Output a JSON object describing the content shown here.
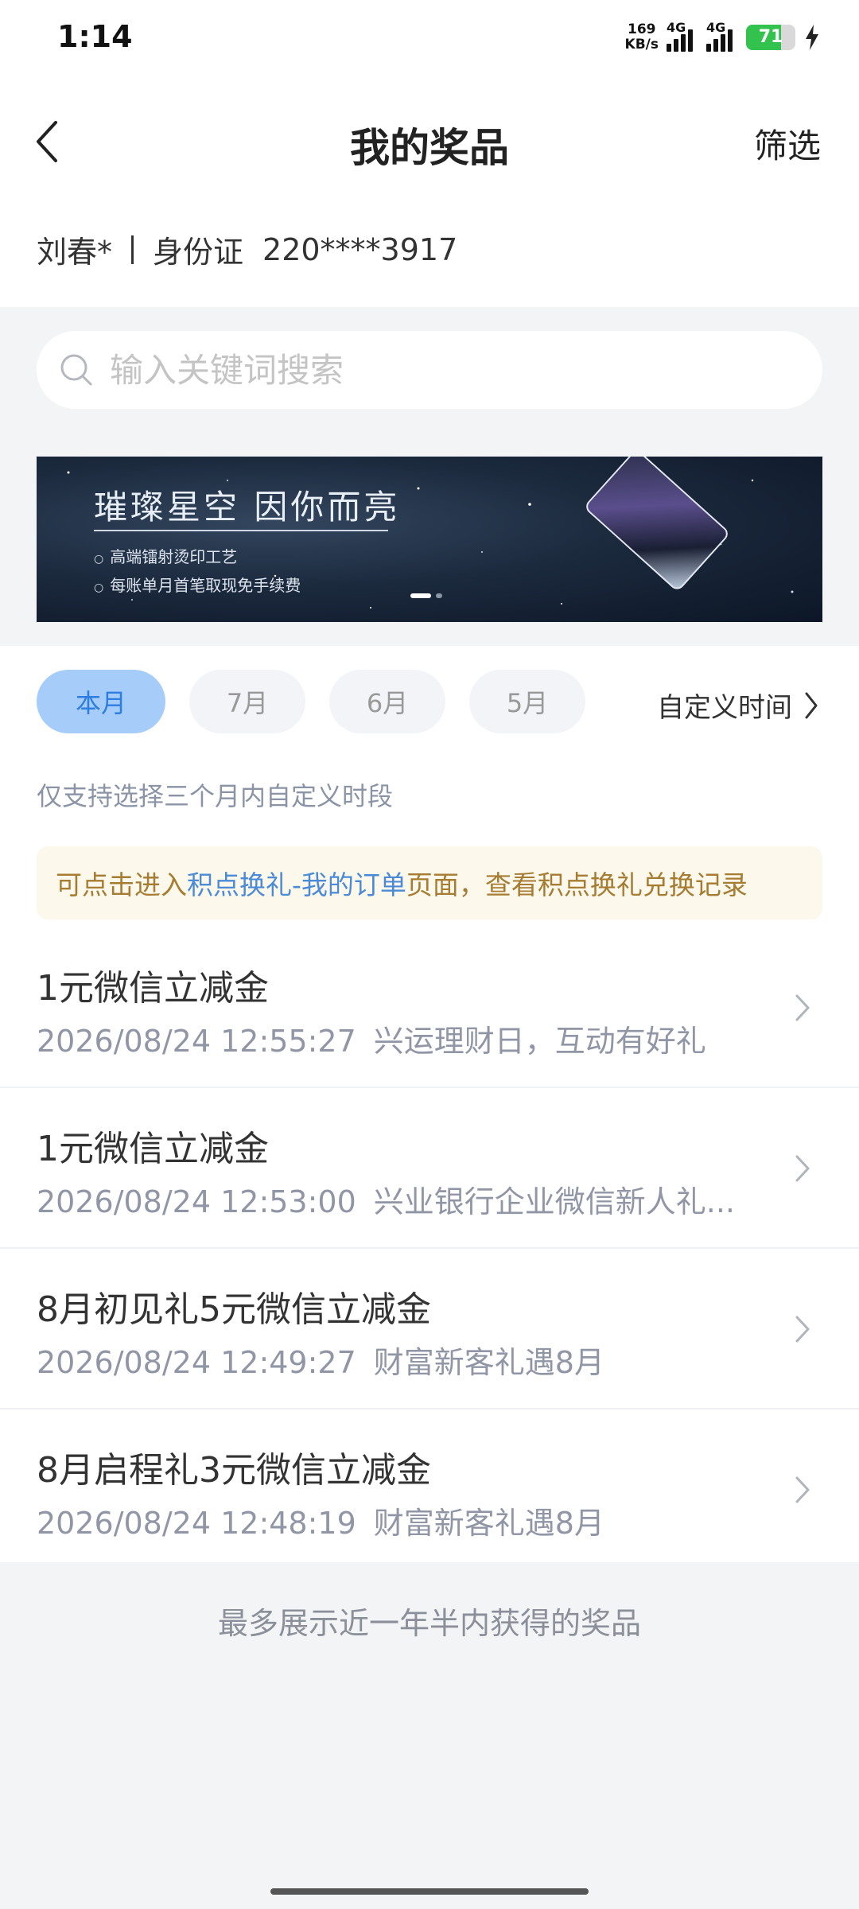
{
  "status_bar": {
    "time": "1:14",
    "net_speed_value": "169",
    "net_speed_unit": "KB/s",
    "signal_1_label": "4G",
    "signal_2_label": "4G",
    "battery_level": "71"
  },
  "header": {
    "title": "我的奖品",
    "filter_label": "筛选"
  },
  "user": {
    "name": "刘春*",
    "id_type": "身份证",
    "id_number": "220****3917"
  },
  "search": {
    "placeholder": "输入关键词搜索"
  },
  "banner": {
    "headline": "璀璨星空 因你而亮",
    "bullet_1": "高端镭射烫印工艺",
    "bullet_2": "每账单月首笔取现免手续费"
  },
  "month_tabs": [
    {
      "label": "本月",
      "active": true
    },
    {
      "label": "7月",
      "active": false
    },
    {
      "label": "6月",
      "active": false
    },
    {
      "label": "5月",
      "active": false
    }
  ],
  "custom_time_label": "自定义时间",
  "range_hint": "仅支持选择三个月内自定义时段",
  "notice": {
    "prefix": "可点击进入",
    "link": "积点换礼-我的订单",
    "suffix": "页面，查看积点换礼兑换记录"
  },
  "prizes": [
    {
      "title": "1元微信立减金",
      "time": "2026/08/24 12:55:27",
      "activity": "兴运理财日，互动有好礼"
    },
    {
      "title": "1元微信立减金",
      "time": "2026/08/24 12:53:00",
      "activity": "兴业银行企业微信新人礼..."
    },
    {
      "title": "8月初见礼5元微信立减金",
      "time": "2026/08/24 12:49:27",
      "activity": "财富新客礼遇8月"
    },
    {
      "title": "8月启程礼3元微信立减金",
      "time": "2026/08/24 12:48:19",
      "activity": "财富新客礼遇8月"
    }
  ],
  "footer_text": "最多展示近一年半内获得的奖品",
  "colors": {
    "accent": "#2e7de0",
    "active_chip_bg": "#a6cdfa",
    "notice_bg": "#fdf8ec",
    "notice_text": "#a57c31",
    "battery_green": "#33c24d"
  }
}
